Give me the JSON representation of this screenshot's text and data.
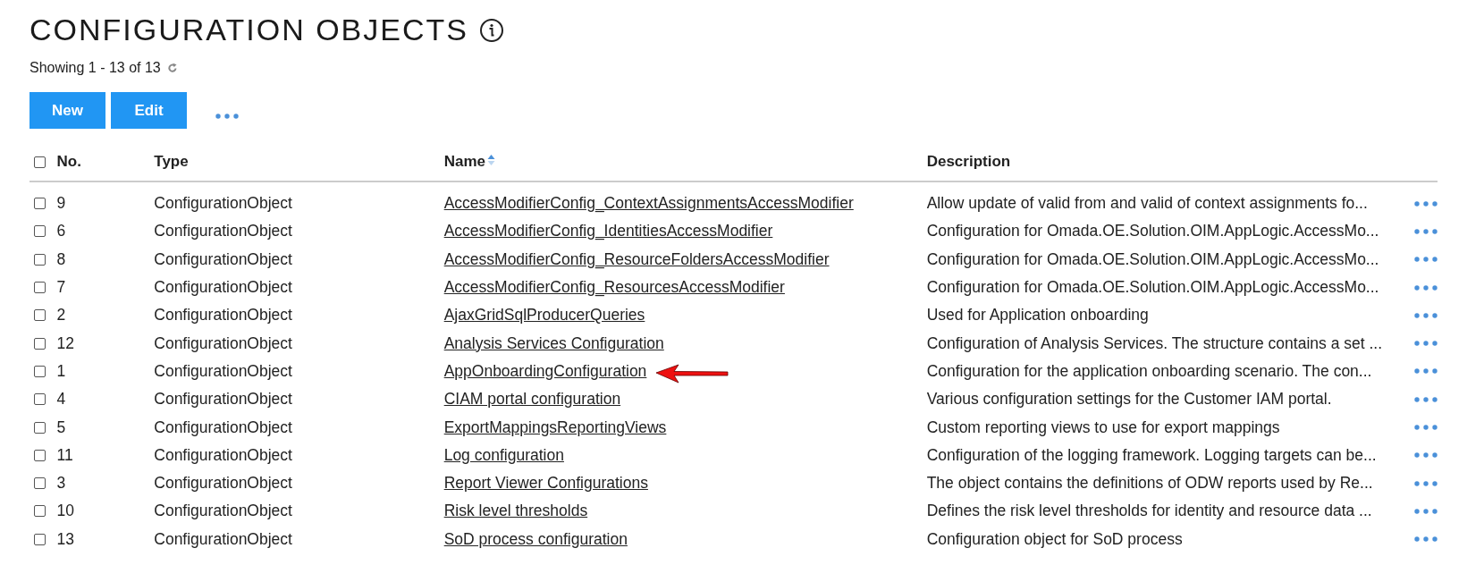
{
  "page": {
    "title": "CONFIGURATION OBJECTS",
    "showing": "Showing 1 - 13 of 13"
  },
  "toolbar": {
    "buttons": [
      "New",
      "Edit"
    ]
  },
  "table": {
    "select_all": {
      "checked": false
    },
    "columns": [
      {
        "label": "No.",
        "sorted": false
      },
      {
        "label": "Type",
        "sorted": false
      },
      {
        "label": "Name",
        "sorted": true
      },
      {
        "label": "Description",
        "sorted": false
      }
    ],
    "rows": [
      {
        "no": "9",
        "type": "ConfigurationObject",
        "name": "AccessModifierConfig_ContextAssignmentsAccessModifier",
        "description": "Allow update of valid from and valid of context assignments fo...",
        "checked": false,
        "arrow": false
      },
      {
        "no": "6",
        "type": "ConfigurationObject",
        "name": "AccessModifierConfig_IdentitiesAccessModifier",
        "description": "Configuration for Omada.OE.Solution.OIM.AppLogic.AccessMo...",
        "checked": false,
        "arrow": false
      },
      {
        "no": "8",
        "type": "ConfigurationObject",
        "name": "AccessModifierConfig_ResourceFoldersAccessModifier",
        "description": "Configuration for Omada.OE.Solution.OIM.AppLogic.AccessMo...",
        "checked": false,
        "arrow": false
      },
      {
        "no": "7",
        "type": "ConfigurationObject",
        "name": "AccessModifierConfig_ResourcesAccessModifier",
        "description": "Configuration for Omada.OE.Solution.OIM.AppLogic.AccessMo...",
        "checked": false,
        "arrow": false
      },
      {
        "no": "2",
        "type": "ConfigurationObject",
        "name": "AjaxGridSqlProducerQueries",
        "description": "Used for Application onboarding",
        "checked": false,
        "arrow": false
      },
      {
        "no": "12",
        "type": "ConfigurationObject",
        "name": "Analysis Services Configuration",
        "description": "Configuration of Analysis Services. The structure contains a set ...",
        "checked": false,
        "arrow": false
      },
      {
        "no": "1",
        "type": "ConfigurationObject",
        "name": "AppOnboardingConfiguration",
        "description": "Configuration for the application onboarding scenario. The con...",
        "checked": false,
        "arrow": true
      },
      {
        "no": "4",
        "type": "ConfigurationObject",
        "name": "CIAM portal configuration",
        "description": "Various configuration settings for the Customer IAM portal.",
        "checked": false,
        "arrow": false
      },
      {
        "no": "5",
        "type": "ConfigurationObject",
        "name": "ExportMappingsReportingViews",
        "description": "Custom reporting views to use for export mappings",
        "checked": false,
        "arrow": false
      },
      {
        "no": "11",
        "type": "ConfigurationObject",
        "name": "Log configuration",
        "description": "Configuration of the logging framework. Logging targets can be...",
        "checked": false,
        "arrow": false
      },
      {
        "no": "3",
        "type": "ConfigurationObject",
        "name": "Report Viewer Configurations",
        "description": "The object contains the definitions of ODW reports used by Re...",
        "checked": false,
        "arrow": false
      },
      {
        "no": "10",
        "type": "ConfigurationObject",
        "name": "Risk level thresholds",
        "description": "Defines the risk level thresholds for identity and resource data ...",
        "checked": false,
        "arrow": false
      },
      {
        "no": "13",
        "type": "ConfigurationObject",
        "name": "SoD process configuration",
        "description": "Configuration object for SoD process",
        "checked": false,
        "arrow": false
      }
    ]
  }
}
